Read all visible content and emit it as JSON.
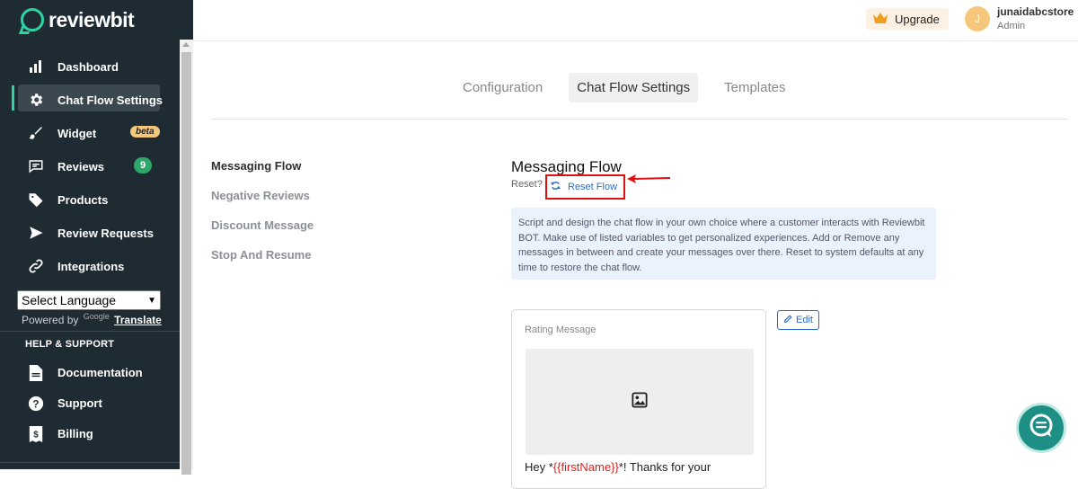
{
  "brand": {
    "name": "reviewbit"
  },
  "sidebar": {
    "items": [
      {
        "label": "Dashboard",
        "icon": "bar-chart-icon",
        "active": false
      },
      {
        "label": "Chat Flow Settings",
        "icon": "gear-icon",
        "active": true
      },
      {
        "label": "Widget",
        "icon": "paintbrush-icon",
        "badge": "beta"
      },
      {
        "label": "Reviews",
        "icon": "reviews-icon",
        "count": "9"
      },
      {
        "label": "Products",
        "icon": "tag-icon"
      },
      {
        "label": "Review Requests",
        "icon": "send-icon"
      },
      {
        "label": "Integrations",
        "icon": "link-icon"
      }
    ],
    "language": {
      "selected": "Select Language",
      "powered_by": "Powered by",
      "google": "Google",
      "translate": "Translate"
    },
    "help_section": "HELP & SUPPORT",
    "help_items": [
      {
        "label": "Documentation",
        "icon": "document-icon"
      },
      {
        "label": "Support",
        "icon": "question-icon"
      },
      {
        "label": "Billing",
        "icon": "billing-icon"
      }
    ]
  },
  "header": {
    "upgrade_label": "Upgrade",
    "user": {
      "initial": "J",
      "name": "junaidabcstore",
      "role": "Admin"
    }
  },
  "tabs": [
    "Configuration",
    "Chat Flow Settings",
    "Templates"
  ],
  "active_tab": "Chat Flow Settings",
  "subnav": [
    "Messaging Flow",
    "Negative Reviews",
    "Discount Message",
    "Stop And Resume"
  ],
  "main": {
    "title": "Messaging Flow",
    "reset_question": "Reset?",
    "reset_label": "Reset Flow",
    "info_text": "Script and design the chat flow in your own choice where a customer interacts with Reviewbit BOT. Make use of listed variables to get personalized experiences. Add or Remove any messages in between and create your messages over there. Reset to system defaults at any time to restore the chat flow.",
    "card": {
      "label": "Rating Message",
      "text_before": "Hey *",
      "variable": "{{firstName}}",
      "text_after": "*! Thanks for your"
    },
    "edit_label": "Edit"
  },
  "colors": {
    "sidebar_bg": "#1f2b33",
    "accent": "#2dd4a3",
    "link": "#2a6bd1",
    "annotation": "#e01010",
    "fab": "#1e8f84"
  }
}
